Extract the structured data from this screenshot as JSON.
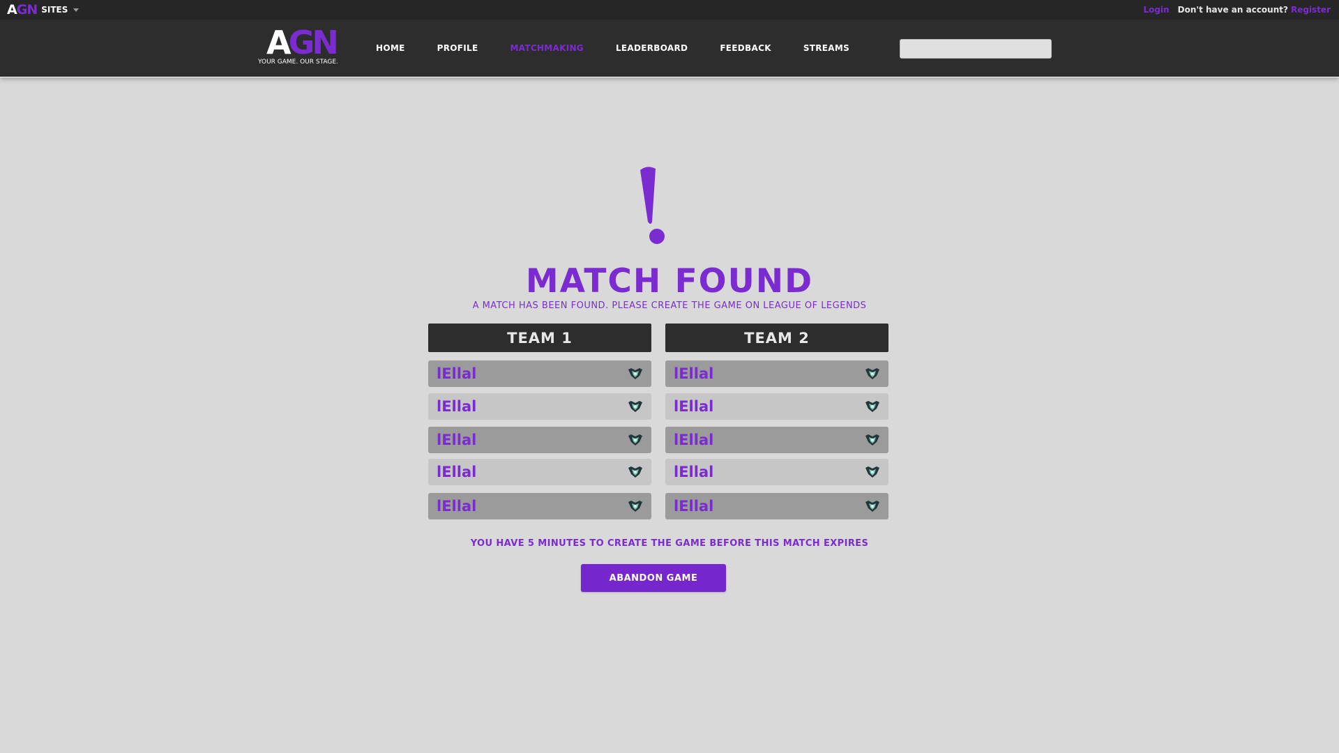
{
  "colors": {
    "accent": "#7b2cd0",
    "header_bg": "#2d2d2d",
    "topbar_bg": "#262626",
    "page_bg": "#d9d9d9",
    "player_row_dark": "#9b9b9b",
    "player_row_light": "#c6c6c6"
  },
  "topbar": {
    "logo_a": "A",
    "logo_gn": "GN",
    "sites_label": "SITES",
    "login_label": "Login",
    "no_account_text": "Don't have an account?",
    "register_label": "Register"
  },
  "header": {
    "logo_a": "A",
    "logo_gn": "GN",
    "tagline": "YOUR GAME. OUR STAGE.",
    "nav": [
      {
        "label": "HOME"
      },
      {
        "label": "PROFILE"
      },
      {
        "label": "MATCHMAKING"
      },
      {
        "label": "LEADERBOARD"
      },
      {
        "label": "FEEDBACK"
      },
      {
        "label": "STREAMS"
      }
    ],
    "active_nav": "MATCHMAKING",
    "search": {
      "value": "",
      "placeholder": ""
    }
  },
  "match": {
    "icon": "exclamation-icon",
    "title": "MATCH FOUND",
    "subtitle": "A MATCH HAS BEEN FOUND. PLEASE CREATE THE GAME ON LEAGUE OF LEGENDS",
    "teams": [
      {
        "name": "TEAM 1",
        "players": [
          {
            "name": "lEllal",
            "rank_icon": "rank-badge-icon"
          },
          {
            "name": "lEllal",
            "rank_icon": "rank-badge-icon"
          },
          {
            "name": "lEllal",
            "rank_icon": "rank-badge-icon"
          },
          {
            "name": "lEllal",
            "rank_icon": "rank-badge-icon"
          },
          {
            "name": "lEllal",
            "rank_icon": "rank-badge-icon"
          }
        ]
      },
      {
        "name": "TEAM 2",
        "players": [
          {
            "name": "lEllal",
            "rank_icon": "rank-badge-icon"
          },
          {
            "name": "lEllal",
            "rank_icon": "rank-badge-icon"
          },
          {
            "name": "lEllal",
            "rank_icon": "rank-badge-icon"
          },
          {
            "name": "lEllal",
            "rank_icon": "rank-badge-icon"
          },
          {
            "name": "lEllal",
            "rank_icon": "rank-badge-icon"
          }
        ]
      }
    ],
    "notice": "YOU HAVE 5 MINUTES TO CREATE THE GAME BEFORE THIS MATCH EXPIRES",
    "abandon_label": "ABANDON GAME"
  }
}
